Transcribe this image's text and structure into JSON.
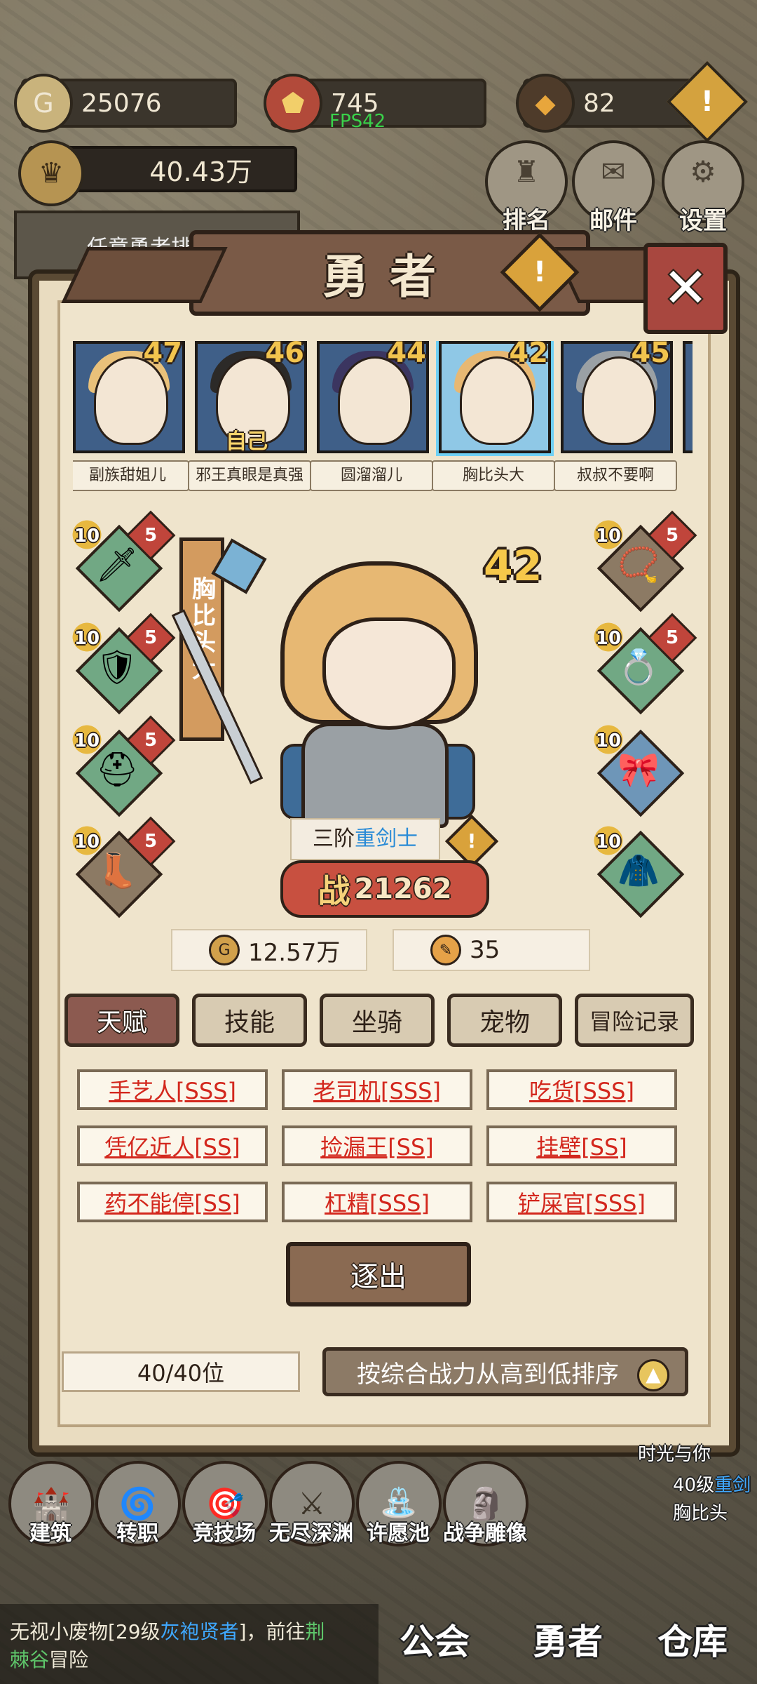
{
  "resources": {
    "gold": "25076",
    "honor": "745",
    "crystal": "82",
    "fps": "FPS42",
    "total_power": "40.43万"
  },
  "top_buttons": [
    {
      "label": "排名",
      "icon": "rank-icon"
    },
    {
      "label": "邮件",
      "icon": "mail-icon"
    },
    {
      "label": "设置",
      "icon": "gear-icon"
    }
  ],
  "task_text": "任意勇者排",
  "panel": {
    "title": "勇者"
  },
  "heroes": [
    {
      "name": "副族甜姐儿",
      "level": "47",
      "tag": "",
      "hair": "#e9c17a"
    },
    {
      "name": "邪王真眼是真强",
      "level": "46",
      "tag": "自己",
      "hair": "#2c2a28"
    },
    {
      "name": "圆溜溜儿",
      "level": "44",
      "tag": "",
      "hair": "#3b3560"
    },
    {
      "name": "胸比头大",
      "level": "42",
      "tag": "",
      "hair": "#e7b873",
      "selected": true
    },
    {
      "name": "叔叔不要啊",
      "level": "45",
      "tag": "",
      "hair": "#9aa0a4"
    }
  ],
  "selected_hero": {
    "name": "胸比头大",
    "level": "42",
    "class_prefix": "三阶",
    "class_name": "重剑士",
    "combat_label": "战",
    "combat": "21262",
    "gold": "12.57万",
    "tickets": "35"
  },
  "equipment_left": [
    {
      "lv": "10",
      "star": "5",
      "icon": "sword-icon",
      "glyph": "🗡",
      "color": "green"
    },
    {
      "lv": "10",
      "star": "5",
      "icon": "armor-icon",
      "glyph": "🛡",
      "color": "green"
    },
    {
      "lv": "10",
      "star": "5",
      "icon": "helmet-icon",
      "glyph": "⛑",
      "color": "green"
    },
    {
      "lv": "10",
      "star": "5",
      "icon": "boots-icon",
      "glyph": "👢",
      "color": "brown"
    }
  ],
  "equipment_right": [
    {
      "lv": "10",
      "star": "5",
      "icon": "necklace-icon",
      "glyph": "📿",
      "color": "brown"
    },
    {
      "lv": "10",
      "star": "5",
      "icon": "ring-icon",
      "glyph": "💍",
      "color": "green"
    },
    {
      "lv": "10",
      "star": "",
      "icon": "belt-icon",
      "glyph": "🎀",
      "color": "blue"
    },
    {
      "lv": "10",
      "star": "",
      "icon": "cape-icon",
      "glyph": "🧥",
      "color": "green"
    }
  ],
  "tabs": [
    "天赋",
    "技能",
    "坐骑",
    "宠物",
    "冒险记录"
  ],
  "talents": [
    "手艺人[SSS]",
    "老司机[SSS]",
    "吃货[SSS]",
    "凭亿近人[SS]",
    "捡漏王[SS]",
    "挂壁[SS]",
    "药不能停[SS]",
    "杠精[SSS]",
    "铲屎官[SSS]"
  ],
  "expel_label": "逐出",
  "roster_count": "40/40位",
  "sort_label": "按综合战力从高到低排序",
  "bottom_nav": [
    {
      "label": "建筑",
      "icon": "castle-icon",
      "glyph": "🏰"
    },
    {
      "label": "转职",
      "icon": "swirl-icon",
      "glyph": "🌀"
    },
    {
      "label": "竞技场",
      "icon": "target-icon",
      "glyph": "🎯"
    },
    {
      "label": "无尽深渊",
      "icon": "abyss-icon",
      "glyph": "⚔"
    },
    {
      "label": "许愿池",
      "icon": "fountain-icon",
      "glyph": "⛲"
    },
    {
      "label": "战争雕像",
      "icon": "statue-icon",
      "glyph": "🗿"
    }
  ],
  "message": {
    "line1": "无视小废物[29级",
    "hl": "灰袍贤者",
    "line1b": "]，前往",
    "loc1": "荆",
    "loc2": "棘谷",
    "tail": "冒险"
  },
  "main_tabs": [
    "公会",
    "勇者",
    "仓库"
  ],
  "side_notes": {
    "time": "时光与你",
    "level": "40级",
    "level_hl": "重剑",
    "name": "胸比头"
  }
}
